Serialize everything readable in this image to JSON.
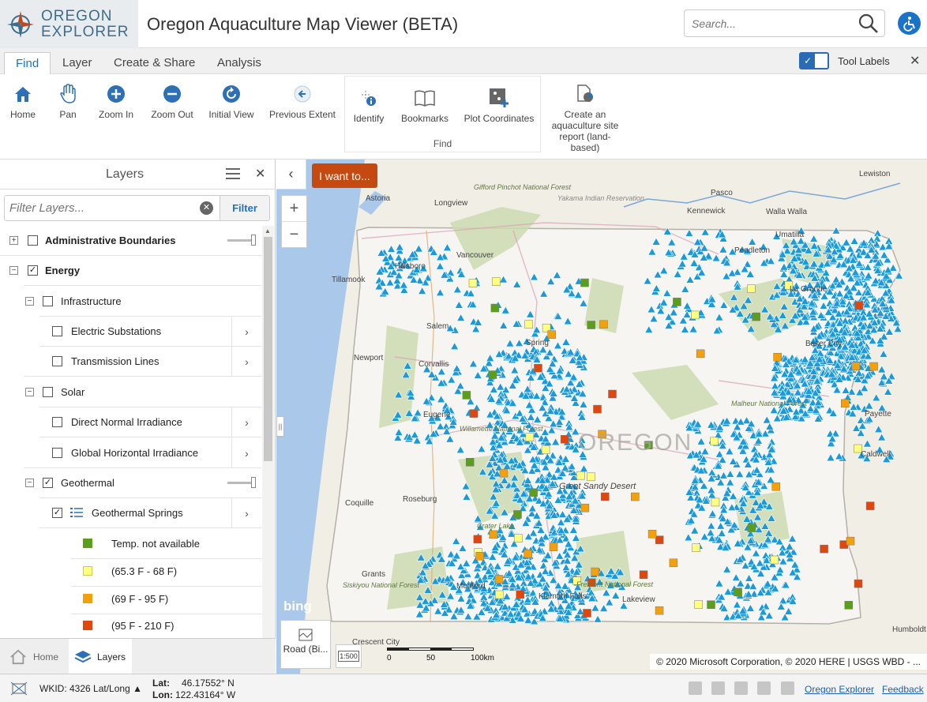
{
  "header": {
    "logo_line1": "OREGON",
    "logo_line2": "EXPLORER",
    "title": "Oregon Aquaculture Map Viewer (BETA)",
    "search_placeholder": "Search..."
  },
  "tabs": {
    "items": [
      "Find",
      "Layer",
      "Create & Share",
      "Analysis"
    ],
    "active": "Find",
    "tool_labels": "Tool Labels",
    "tool_labels_on": true
  },
  "toolbar": {
    "home": "Home",
    "pan": "Pan",
    "zoom_in": "Zoom In",
    "zoom_out": "Zoom Out",
    "initial_view": "Initial View",
    "previous_extent": "Previous Extent",
    "identify": "Identify",
    "bookmarks": "Bookmarks",
    "plot_coordinates": "Plot Coordinates",
    "find_group": "Find",
    "create_report": "Create an aquaculture site report (land-based)"
  },
  "layers": {
    "title": "Layers",
    "filter_placeholder": "Filter Layers...",
    "filter_button": "Filter",
    "items": [
      {
        "label": "Administrative Boundaries",
        "checked": false
      },
      {
        "label": "Energy",
        "checked": true
      },
      {
        "label": "Infrastructure",
        "checked": false
      },
      {
        "label": "Electric Substations",
        "checked": false
      },
      {
        "label": "Transmission Lines",
        "checked": false
      },
      {
        "label": "Solar",
        "checked": false
      },
      {
        "label": "Direct Normal Irradiance",
        "checked": false
      },
      {
        "label": "Global Horizontal Irradiance",
        "checked": false
      },
      {
        "label": "Geothermal",
        "checked": true
      },
      {
        "label": "Geothermal Springs",
        "checked": true
      }
    ],
    "legend": [
      {
        "label": "Temp. not available",
        "color": "#5a9e1b"
      },
      {
        "label": "(65.3 F - 68 F)",
        "color": "#ffff80"
      },
      {
        "label": "(69 F - 95 F)",
        "color": "#f2a10c"
      },
      {
        "label": "(95 F - 210 F)",
        "color": "#e0460e"
      }
    ],
    "bottom_home": "Home",
    "bottom_layers": "Layers"
  },
  "map": {
    "i_want_to": "I want to...",
    "bing": "bing",
    "basemap": "Road (Bi...",
    "scale_label": "1:500",
    "scale_ticks": [
      "0",
      "50",
      "100km"
    ],
    "attribution": "© 2020 Microsoft Corporation, © 2020 HERE | USGS WBD - ...",
    "state_label": "OREGON",
    "places": [
      "Astoria",
      "Longview",
      "Vancouver",
      "Hillsboro",
      "Tillamook",
      "Salem",
      "Newport",
      "Corvallis",
      "Eugene",
      "Roseburg",
      "Coquille",
      "Grants",
      "Medford",
      "Klamath Falls",
      "Lakeview",
      "Kennewick",
      "Walla Walla",
      "Pasco",
      "Lewiston",
      "Pendleton",
      "La Grande",
      "Baker City",
      "Payette",
      "Caldwell",
      "Great Sandy Desert",
      "Malheur National Forest",
      "Humboldt",
      "Crescent City",
      "Gifford Pinchot National Forest",
      "Yakama Indian Reservation",
      "Willamette National Forest",
      "Crater Lake",
      "Siskiyou National Forest",
      "Fremont National Forest",
      "Umatilla",
      "Spring"
    ],
    "springs_color": "#1a9ad9"
  },
  "status": {
    "wkid": "WKID: 4326 Lat/Long",
    "lat_label": "Lat:",
    "lat_value": "46.17552° N",
    "lon_label": "Lon:",
    "lon_value": "122.43164° W",
    "link_explorer": "Oregon Explorer",
    "link_feedback": "Feedback"
  }
}
